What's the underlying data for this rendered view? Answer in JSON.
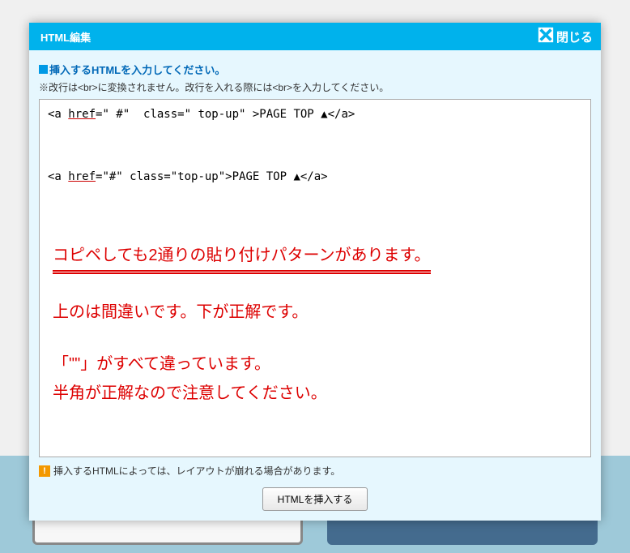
{
  "modal": {
    "title": "HTML編集",
    "close_label": "閉じる",
    "instruction": "挿入するHTMLを入力してください。",
    "note": "※改行は<br>に変換されません。改行を入れる際には<br>を入力してください。",
    "warning": "挿入するHTMLによっては、レイアウトが崩れる場合があります。",
    "insert_button": "HTMLを挿入する"
  },
  "editor": {
    "line1": "<a href=\" #\"  class=\" top-up\" >PAGE TOP ▲</a>",
    "line2": "<a href=\"#\" class=\"top-up\">PAGE TOP ▲</a>"
  },
  "annotation": {
    "l1": "コピペしても2通りの貼り付けパターンがあります。",
    "l2": "上のは間違いです。下が正解です。",
    "l3": "「\"\"」がすべて違っています。",
    "l4": "半角が正解なので注意してください。"
  }
}
